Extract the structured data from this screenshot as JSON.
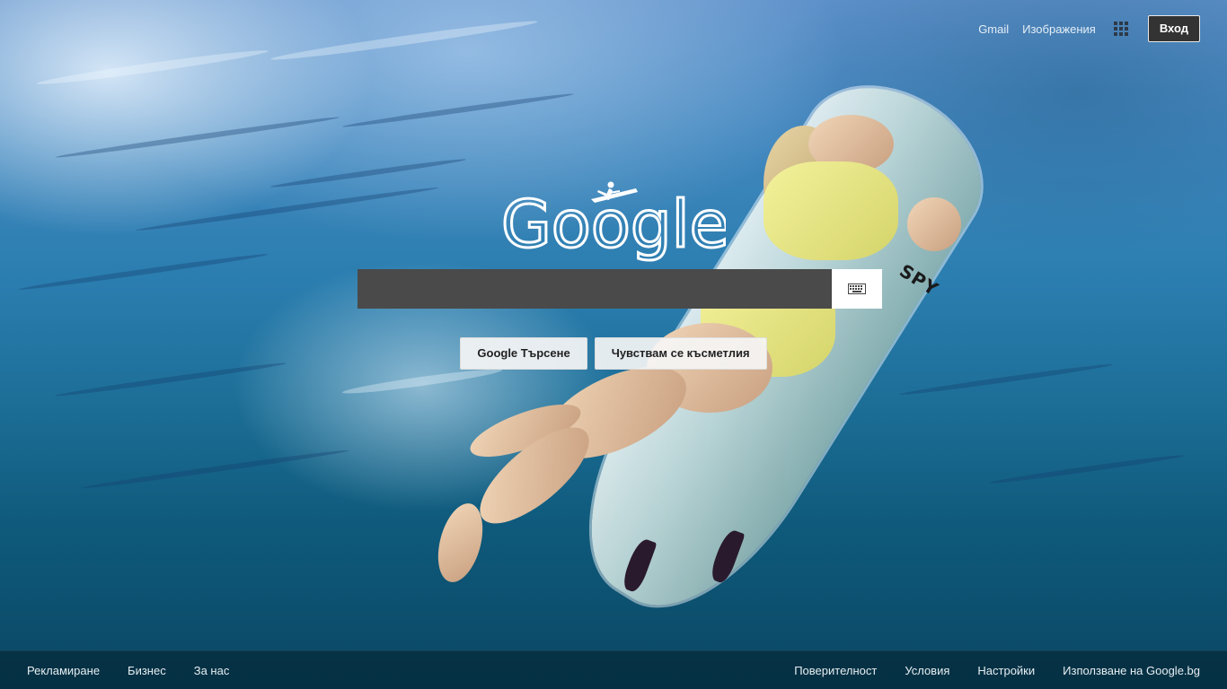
{
  "header": {
    "gmail": "Gmail",
    "images": "Изображения",
    "signin": "Вход"
  },
  "logo": {
    "text": "Google"
  },
  "search": {
    "value": "",
    "placeholder": ""
  },
  "buttons": {
    "search": "Google Търсене",
    "lucky": "Чувствам се късметлия"
  },
  "footer": {
    "left": [
      "Рекламиране",
      "Бизнес",
      "За нас"
    ],
    "right": [
      "Поверителност",
      "Условия",
      "Настройки",
      "Използване на Google.bg"
    ]
  },
  "icons": {
    "apps": "apps-grid-icon",
    "keyboard": "keyboard-icon"
  },
  "colors": {
    "signin_bg": "#333333",
    "search_field": "#4a4a4a",
    "footer_bg": "#04283880"
  }
}
